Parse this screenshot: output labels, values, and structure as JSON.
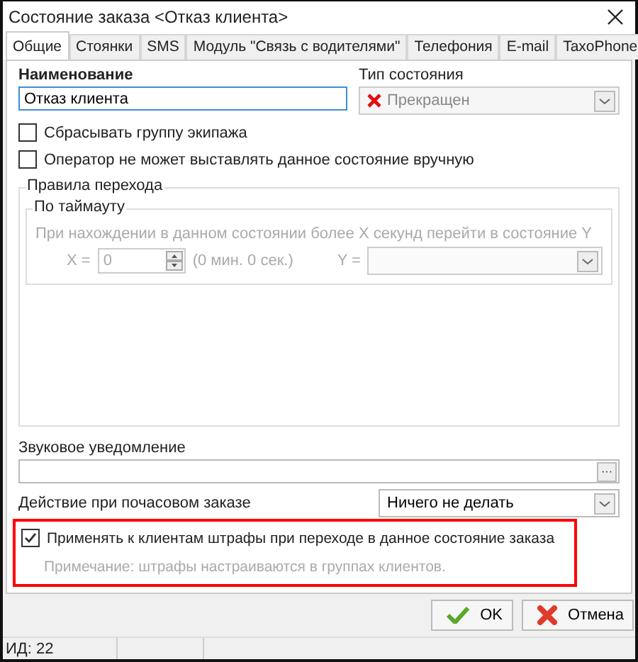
{
  "window": {
    "title": "Состояние заказа <Отказ клиента>"
  },
  "tabs": [
    {
      "label": "Общие",
      "selected": true
    },
    {
      "label": "Стоянки",
      "selected": false
    },
    {
      "label": "SMS",
      "selected": false
    },
    {
      "label": "Модуль \"Связь с водителями\"",
      "selected": false
    },
    {
      "label": "Телефония",
      "selected": false
    },
    {
      "label": "E-mail",
      "selected": false
    },
    {
      "label": "TaxoPhone",
      "selected": false
    }
  ],
  "name": {
    "label": "Наименование",
    "value": "Отказ клиента"
  },
  "state_type": {
    "label": "Тип состояния",
    "value": "Прекращен",
    "disabled": true
  },
  "checkboxes": [
    {
      "label": "Сбрасывать группу экипажа",
      "checked": false
    },
    {
      "label": "Оператор не может выставлять данное состояние вручную",
      "checked": false
    }
  ],
  "transition_rules": {
    "title": "Правила перехода",
    "timeout": {
      "title": "По таймауту",
      "disabled": true,
      "description": "При нахождении в данном состоянии более X секунд перейти в состояние Y",
      "x_label": "X =",
      "x_value": "0",
      "x_hint": "(0 мин. 0 сек.)",
      "y_label": "Y ="
    }
  },
  "sound": {
    "label": "Звуковое уведомление",
    "browse": "···"
  },
  "hourly_action": {
    "label": "Действие при почасовом заказе",
    "value": "Ничего не делать"
  },
  "penalty": {
    "label": "Применять к клиентам штрафы при переходе в данное состояние заказа",
    "checked": true,
    "note": "Примечание: штрафы настраиваются в группах клиентов."
  },
  "buttons": [
    {
      "kind": "ok",
      "label": "OK"
    },
    {
      "kind": "cancel",
      "label": "Отмена"
    }
  ],
  "status_bar": {
    "id": "ИД: 22"
  }
}
